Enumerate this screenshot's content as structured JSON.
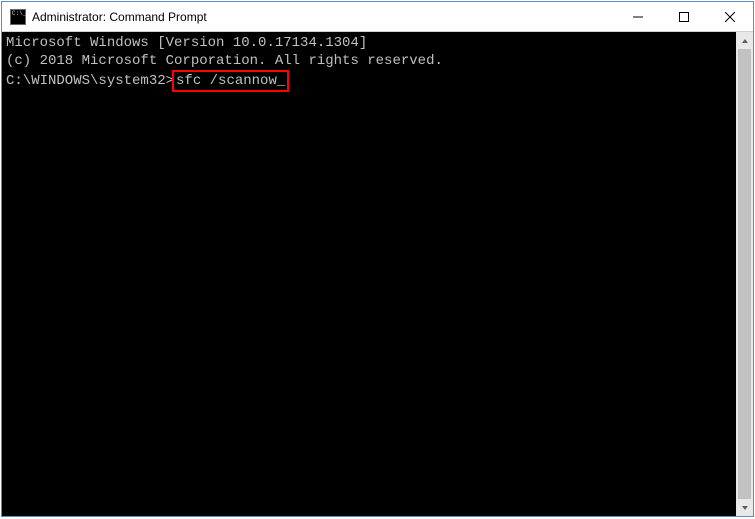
{
  "window": {
    "title": "Administrator: Command Prompt"
  },
  "terminal": {
    "line1": "Microsoft Windows [Version 10.0.17134.1304]",
    "line2": "(c) 2018 Microsoft Corporation. All rights reserved.",
    "blank": "",
    "prompt": "C:\\WINDOWS\\system32>",
    "command": "sfc /scannow",
    "cursor": "_"
  }
}
